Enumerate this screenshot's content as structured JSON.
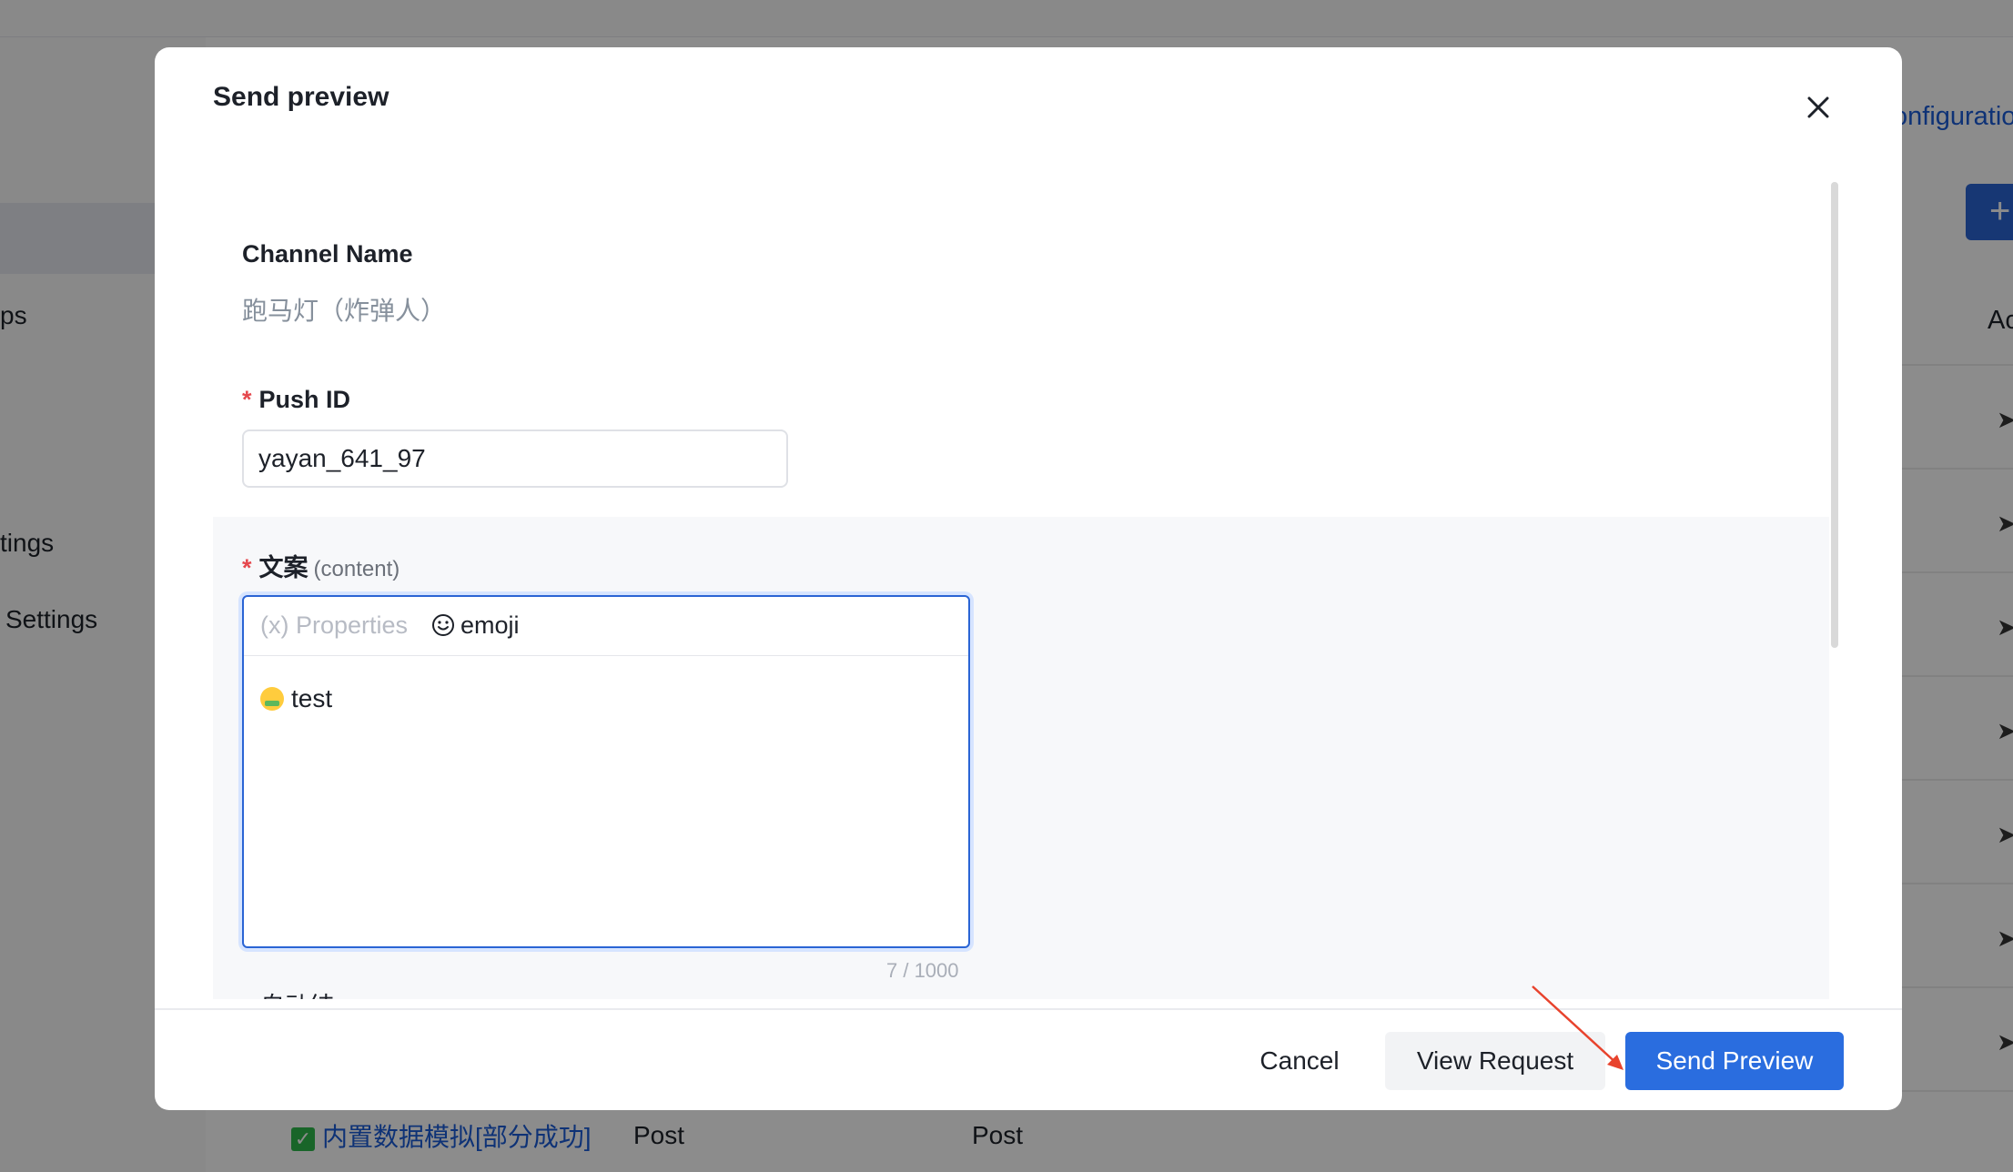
{
  "background": {
    "sidebar_items": [
      "ps",
      "tings",
      "Settings"
    ],
    "config_link": "onfiguratio",
    "plus": "+",
    "table_header_partial": "Ac",
    "bottom_row_link": "内置数据模拟[部分成功]",
    "bottom_row_method_1": "Post",
    "bottom_row_method_2": "Post"
  },
  "modal": {
    "title": "Send preview",
    "close_icon": "close-icon",
    "channel_name_label": "Channel Name",
    "channel_name_value": "跑马灯（炸弹人）",
    "push_id_label": "Push ID",
    "push_id_value": "yayan_641_97",
    "content_label": "文案",
    "content_sublabel": "(content)",
    "toolbar_properties": "(x) Properties",
    "toolbar_emoji": "emoji",
    "editor_text": "test",
    "counter": "7 / 1000",
    "next_field_label_partial": "自动结",
    "required_mark": "*"
  },
  "footer": {
    "cancel_label": "Cancel",
    "view_request_label": "View Request",
    "send_preview_label": "Send Preview"
  },
  "colors": {
    "primary": "#2a6ddf",
    "required": "#e5484d",
    "annotation_arrow": "#e8432d"
  }
}
